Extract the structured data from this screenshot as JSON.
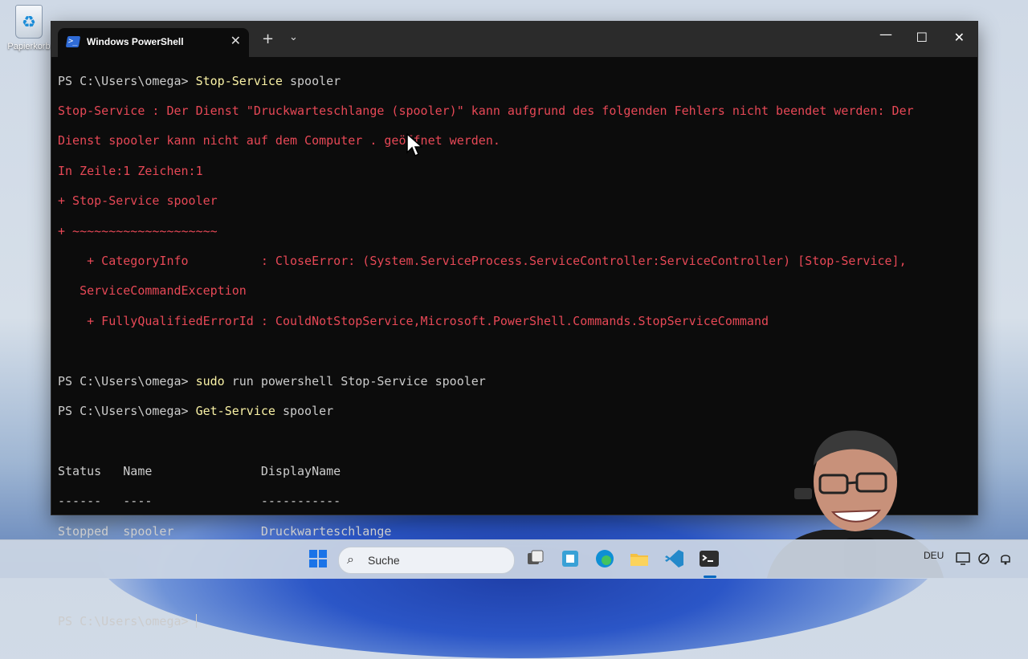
{
  "desktop": {
    "recycle_bin_label": "Papierkorb"
  },
  "window": {
    "tab_title": "Windows PowerShell",
    "tab_close": "✕",
    "new_tab": "+",
    "dropdown": "⌄",
    "minimize": "—",
    "maximize": "☐",
    "close": "✕"
  },
  "console": {
    "prompt": "PS C:\\Users\\omega> ",
    "line1_cmd": "Stop-Service",
    "line1_arg": " spooler",
    "err1": "Stop-Service : Der Dienst \"Druckwarteschlange (spooler)\" kann aufgrund des folgenden Fehlers nicht beendet werden: Der",
    "err2": "Dienst spooler kann nicht auf dem Computer . geöffnet werden.",
    "err3": "In Zeile:1 Zeichen:1",
    "err4": "+ Stop-Service spooler",
    "err5": "+ ~~~~~~~~~~~~~~~~~~~~",
    "err6": "    + CategoryInfo          : CloseError: (System.ServiceProcess.ServiceController:ServiceController) [Stop-Service],",
    "err7": "   ServiceCommandException",
    "err8": "    + FullyQualifiedErrorId : CouldNotStopService,Microsoft.PowerShell.Commands.StopServiceCommand",
    "line2_cmd": "sudo",
    "line2_arg": " run powershell Stop-Service spooler",
    "line3_cmd": "Get-Service",
    "line3_arg": " spooler",
    "table_header": "Status   Name               DisplayName",
    "table_rule": "------   ----               -----------",
    "table_row": "Stopped  spooler            Druckwarteschlange"
  },
  "taskbar": {
    "search_label": "Suche",
    "language": "DEU",
    "apps": [
      "start-icon",
      "task-view-icon",
      "widgets-icon",
      "edge-icon",
      "file-explorer-icon",
      "vscode-icon",
      "terminal-icon"
    ]
  },
  "colors": {
    "console_bg": "#0c0c0c",
    "command": "#f9f1a5",
    "error": "#e74856",
    "text": "#cccccc"
  }
}
